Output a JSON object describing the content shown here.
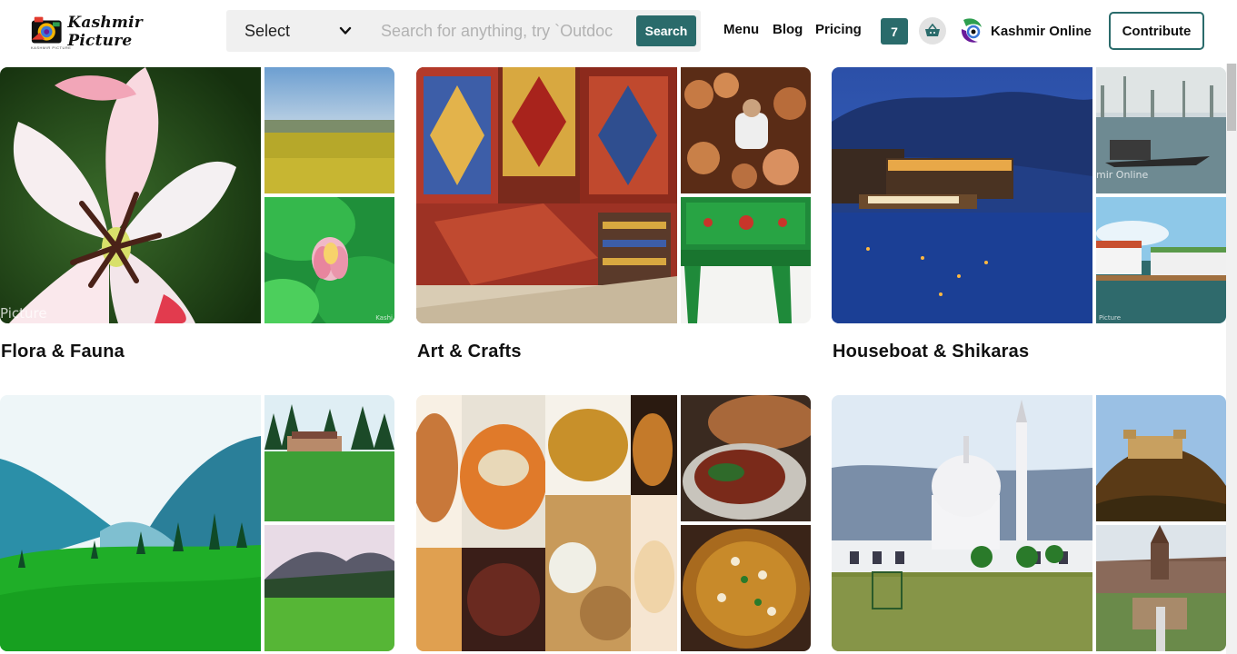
{
  "header": {
    "logo_text": "Kashmir Picture",
    "logo_subtext": "KASHMIR PICTURE",
    "select_label": "Select",
    "search_placeholder": "Search for anything, try `Outdoc",
    "search_button": "Search",
    "nav": [
      "Menu",
      "Blog",
      "Pricing"
    ],
    "notification_count": "7",
    "cart_icon": "basket-icon",
    "profile_name": "Kashmir Online",
    "contribute_label": "Contribute"
  },
  "categories": [
    {
      "title": "Flora & Fauna",
      "watermark_big": "Picture",
      "watermark_small": "Kashi"
    },
    {
      "title": "Art & Crafts"
    },
    {
      "title": "Houseboat & Shikaras",
      "watermark_small": "mir Online",
      "watermark_small2": "Picture"
    },
    {
      "title": ""
    },
    {
      "title": ""
    },
    {
      "title": ""
    }
  ],
  "colors": {
    "accent": "#2a6b6b",
    "search_bg": "#f0f0f0",
    "cart_bg": "#e2e2e2"
  }
}
